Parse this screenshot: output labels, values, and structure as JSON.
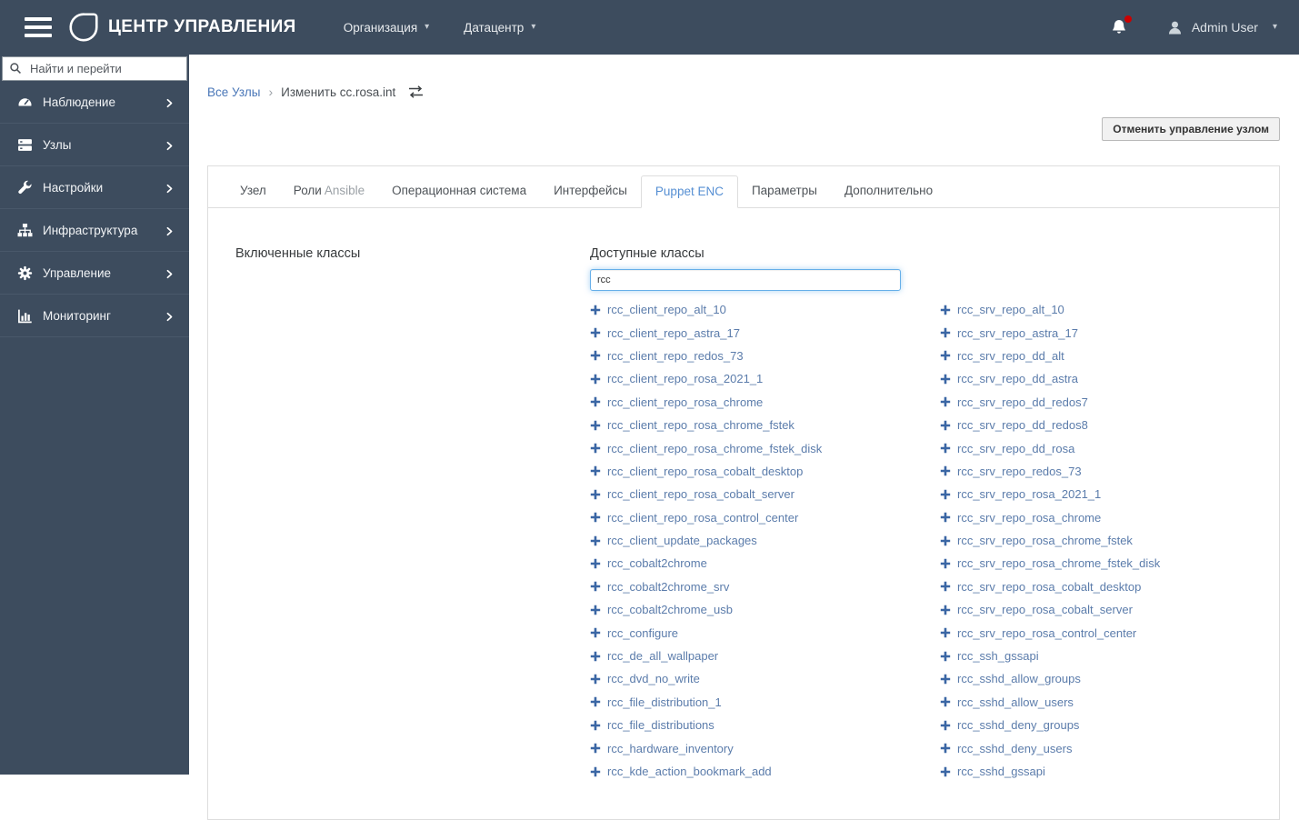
{
  "topbar": {
    "title": "ЦЕНТР УПРАВЛЕНИЯ",
    "menus": [
      {
        "label": "Организация"
      },
      {
        "label": "Датацентр"
      }
    ],
    "user": {
      "name": "Admin User"
    },
    "notifications": {
      "unread_badge": true
    }
  },
  "sidebar": {
    "search_placeholder": "Найти и перейти",
    "items": [
      {
        "key": "monitor",
        "label": "Наблюдение",
        "icon": "gauge-icon"
      },
      {
        "key": "hosts",
        "label": "Узлы",
        "icon": "hosts-icon"
      },
      {
        "key": "configure",
        "label": "Настройки",
        "icon": "wrench-icon"
      },
      {
        "key": "infrastructure",
        "label": "Инфраструктура",
        "icon": "sitemap-icon"
      },
      {
        "key": "administer",
        "label": "Управление",
        "icon": "gear-icon"
      },
      {
        "key": "monitoring",
        "label": "Мониторинг",
        "icon": "bar-chart-icon"
      }
    ]
  },
  "breadcrumb": {
    "link": "Все Узлы",
    "separator": "›",
    "current": "Изменить cc.rosa.int"
  },
  "actions": {
    "cancel_manage_label": "Отменить управление узлом"
  },
  "tabs": [
    {
      "label": "Узел"
    },
    {
      "label": "Роли",
      "suffix": "Ansible"
    },
    {
      "label": "Операционная система"
    },
    {
      "label": "Интерфейсы"
    },
    {
      "label": "Puppet ENC",
      "active": true
    },
    {
      "label": "Параметры"
    },
    {
      "label": "Дополнительно"
    }
  ],
  "puppet_enc": {
    "included_header": "Включенные классы",
    "available_header": "Доступные классы",
    "filter_value": "rcc",
    "included_classes": [],
    "available_classes": [
      "rcc_client_repo_alt_10",
      "rcc_client_repo_astra_17",
      "rcc_client_repo_redos_73",
      "rcc_client_repo_rosa_2021_1",
      "rcc_client_repo_rosa_chrome",
      "rcc_client_repo_rosa_chrome_fstek",
      "rcc_client_repo_rosa_chrome_fstek_disk",
      "rcc_client_repo_rosa_cobalt_desktop",
      "rcc_client_repo_rosa_cobalt_server",
      "rcc_client_repo_rosa_control_center",
      "rcc_client_update_packages",
      "rcc_cobalt2chrome",
      "rcc_cobalt2chrome_srv",
      "rcc_cobalt2chrome_usb",
      "rcc_configure",
      "rcc_de_all_wallpaper",
      "rcc_dvd_no_write",
      "rcc_file_distribution_1",
      "rcc_file_distributions",
      "rcc_hardware_inventory",
      "rcc_kde_action_bookmark_add",
      "rcc_srv_repo_alt_10",
      "rcc_srv_repo_astra_17",
      "rcc_srv_repo_dd_alt",
      "rcc_srv_repo_dd_astra",
      "rcc_srv_repo_dd_redos7",
      "rcc_srv_repo_dd_redos8",
      "rcc_srv_repo_dd_rosa",
      "rcc_srv_repo_redos_73",
      "rcc_srv_repo_rosa_2021_1",
      "rcc_srv_repo_rosa_chrome",
      "rcc_srv_repo_rosa_chrome_fstek",
      "rcc_srv_repo_rosa_chrome_fstek_disk",
      "rcc_srv_repo_rosa_cobalt_desktop",
      "rcc_srv_repo_rosa_cobalt_server",
      "rcc_srv_repo_rosa_control_center",
      "rcc_ssh_gssapi",
      "rcc_sshd_allow_groups",
      "rcc_sshd_allow_users",
      "rcc_sshd_deny_groups",
      "rcc_sshd_deny_users",
      "rcc_sshd_gssapi"
    ]
  },
  "colors": {
    "chrome": "#3d4c5e",
    "chrome_divider": "#49586a",
    "breadcrumb_link": "#4a77b8",
    "class_link": "#5b7cab",
    "plus_icon": "#3a66a4",
    "active_tab": "#568fd3",
    "notification_badge": "#cc0000"
  }
}
